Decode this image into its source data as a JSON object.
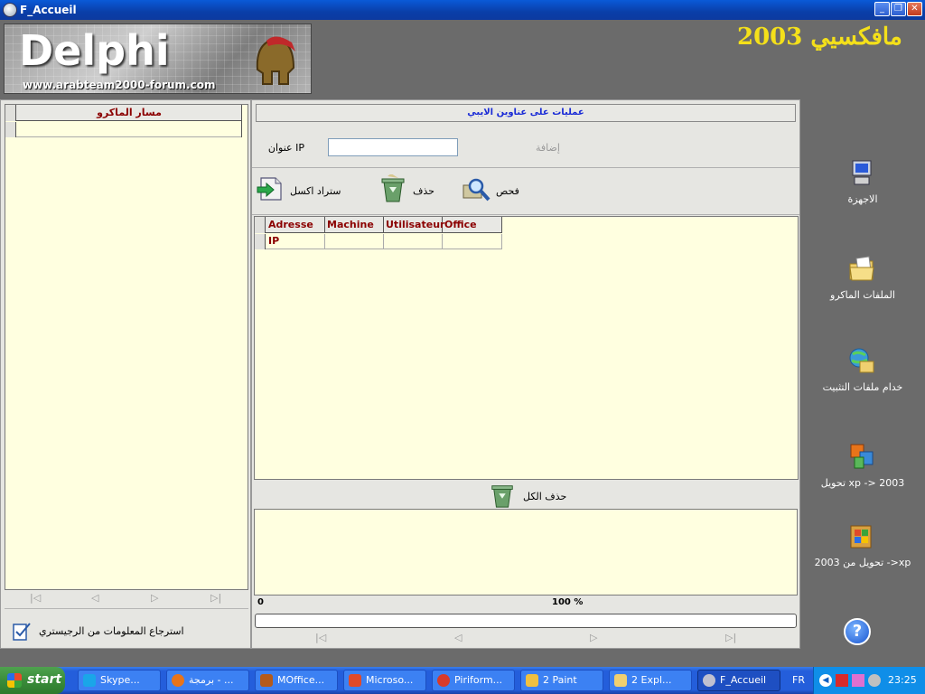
{
  "window": {
    "title": "F_Accueil"
  },
  "header": {
    "logo_word": "Delphi",
    "logo_url": "www.arabteam2000-forum.com",
    "brand_title": "مافكسيي 2003"
  },
  "left": {
    "grid_column": "مسار الماكرو",
    "nav": [
      "|◁",
      "◁",
      "▷",
      "▷|"
    ],
    "registry_label": "استرجاع المعلومات من الرجيستري"
  },
  "center": {
    "title": "عمليات على عناوين الايبي",
    "ip_label": "عنوان IP",
    "ip_value": "",
    "add_label": "إضافة",
    "tools": {
      "import_excel": "ستراد اكسل",
      "delete": "حذف",
      "check": "فحص"
    },
    "grid_columns": [
      "Adresse IP",
      "Machine",
      "Utilisateur",
      "Office"
    ],
    "delete_all": "حذف الكل",
    "progress_min": "0",
    "progress_pct": "100 %",
    "nav": [
      "|◁",
      "◁",
      "▷",
      "▷|"
    ]
  },
  "right": {
    "items": [
      {
        "label": "الاجهزة",
        "icon": "computer-icon"
      },
      {
        "label": "الملفات الماكرو",
        "icon": "folder-icon"
      },
      {
        "label": "خدام ملفات التثبيت",
        "icon": "network-server-icon"
      },
      {
        "label": "تحويل xp -> 2003",
        "icon": "office-convert-icon"
      },
      {
        "label": "تحويل من 2003 ->xp",
        "icon": "office-convert-back-icon"
      }
    ],
    "help": "?"
  },
  "taskbar": {
    "start": "start",
    "tasks": [
      {
        "label": "Skype...",
        "icon_color": "#1aa6e8"
      },
      {
        "label": "برمجة - ...",
        "icon_color": "#e8741a"
      },
      {
        "label": "MOffice...",
        "icon_color": "#b45a1a"
      },
      {
        "label": "Microso...",
        "icon_color": "#e04a2a"
      },
      {
        "label": "Piriform...",
        "icon_color": "#d83a2a"
      },
      {
        "label": "2 Paint",
        "icon_color": "#f0c040"
      },
      {
        "label": "2 Expl...",
        "icon_color": "#f0d070"
      },
      {
        "label": "F_Accueil",
        "icon_color": "#c0c0d0"
      }
    ],
    "lang": "FR",
    "clock": "23:25"
  },
  "colors": {
    "grid_bg": "#ffffe0",
    "header_text": "#8b0000",
    "brand_yellow": "#f4e01a",
    "title_blue": "#1a2bd6",
    "panel_bg": "#e6e6e2",
    "dark_bg": "#6b6b6b"
  }
}
